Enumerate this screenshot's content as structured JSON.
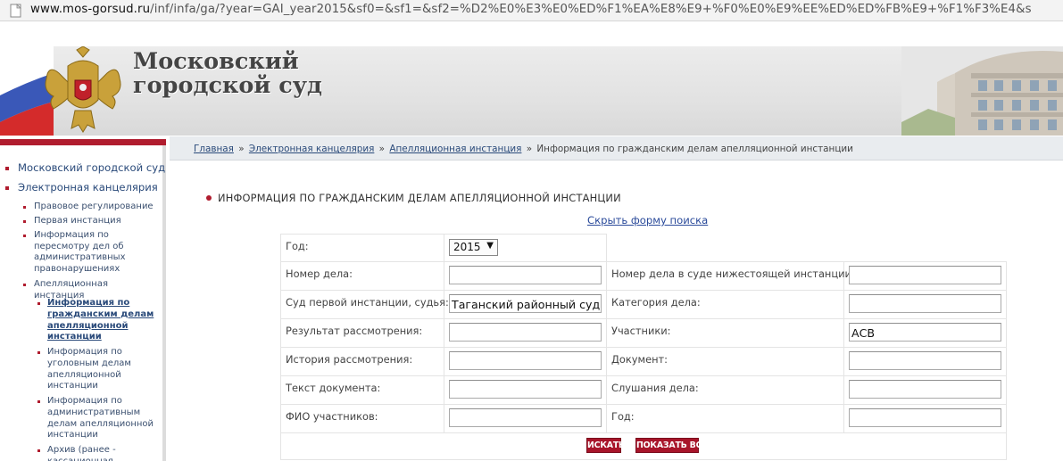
{
  "browser": {
    "url_host": "www.mos-gorsud.ru",
    "url_path": "/inf/infa/ga/?year=GAI_year2015&sf0=&sf1=&sf2=%D2%E0%E3%E0%ED%F1%EA%E8%E9+%F0%E0%E9%EE%ED%ED%FB%E9+%F1%F3%E4&s"
  },
  "header": {
    "title_line1": "Московский",
    "title_line2": "городской суд"
  },
  "sidebar": {
    "items": [
      {
        "label": "Московский городской суд"
      },
      {
        "label": "Электронная канцелярия"
      }
    ],
    "subitems": [
      {
        "label": "Правовое регулирование"
      },
      {
        "label": "Первая инстанция"
      },
      {
        "label": "Информация по пересмотру дел об административных правонарушениях"
      },
      {
        "label": "Апелляционная инстанция"
      }
    ],
    "subsubitems": [
      {
        "label": "Информация по гражданским делам апелляционной инстанции"
      },
      {
        "label": "Информация по уголовным делам апелляционной инстанции"
      },
      {
        "label": "Информация по административным делам апелляционной инстанции"
      },
      {
        "label": "Архив (ранее - кассационная"
      }
    ]
  },
  "breadcrumb": {
    "home": "Главная",
    "ecanc": "Электронная канцелярия",
    "appeal": "Апелляционная инстанция",
    "current": "Информация по гражданским делам апелляционной инстанции",
    "sep": "»"
  },
  "page": {
    "title": "ИНФОРМАЦИЯ ПО ГРАЖДАНСКИМ ДЕЛАМ АПЕЛЛЯЦИОННОЙ ИНСТАНЦИИ",
    "toggle_search": "Скрыть форму поиска"
  },
  "form": {
    "year_label": "Год:",
    "year_value": "2015",
    "case_no_label": "Номер дела:",
    "case_no_value": "",
    "lower_case_no_label": "Номер дела в суде нижестоящей инстанции:",
    "lower_case_no_value": "",
    "court_label": "Суд первой инстанции, судья:",
    "court_value": "Таганский районный суд",
    "category_label": "Категория дела:",
    "category_value": "",
    "result_label": "Результат рассмотрения:",
    "result_value": "",
    "participants_label": "Участники:",
    "participants_value": "АСВ",
    "history_label": "История рассмотрения:",
    "history_value": "",
    "document_label": "Документ:",
    "document_value": "",
    "doc_text_label": "Текст документа:",
    "doc_text_value": "",
    "hearings_label": "Слушания дела:",
    "hearings_value": "",
    "fio_label": "ФИО участников:",
    "fio_value": "",
    "year2_label": "Год:",
    "year2_value": "",
    "search_button": "ИСКАТЬ",
    "show_all_button": "ПОКАЗАТЬ ВСЕ"
  },
  "colors": {
    "accent_red": "#b01c2e",
    "link_blue": "#2a4a7a"
  }
}
